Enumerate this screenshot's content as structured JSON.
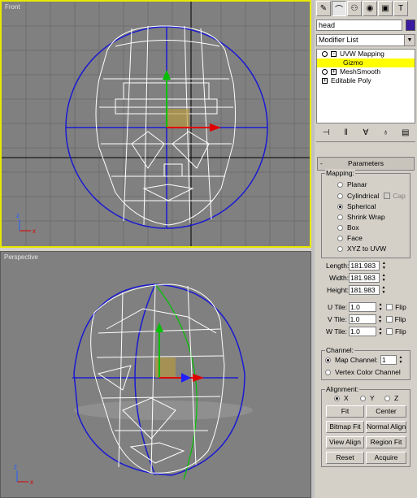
{
  "viewports": {
    "front_label": "Front",
    "perspective_label": "Perspective",
    "axis_x": "x",
    "axis_z": "z"
  },
  "command_panel": {
    "tabs": [
      "create-icon",
      "modify-icon",
      "hierarchy-icon",
      "motion-icon",
      "display-icon",
      "utilities-icon"
    ],
    "object_name": "head",
    "object_color": "#3a1b9f",
    "modifier_list": "Modifier List",
    "stack": {
      "uvw_mapping": "UVW Mapping",
      "gizmo": "Gizmo",
      "meshsmooth": "MeshSmooth",
      "editable_poly": "Editable Poly"
    }
  },
  "parameters": {
    "rollout_title": "Parameters",
    "mapping_title": "Mapping:",
    "mapping_options": [
      "Planar",
      "Cylindrical",
      "Spherical",
      "Shrink Wrap",
      "Box",
      "Face",
      "XYZ to UVW"
    ],
    "cap_label": "Cap",
    "length_label": "Length:",
    "length_value": "181.983",
    "width_label": "Width:",
    "width_value": "181.983",
    "height_label": "Height:",
    "height_value": "181.983",
    "utile_label": "U Tile:",
    "utile_value": "1.0",
    "vtile_label": "V Tile:",
    "vtile_value": "1.0",
    "wtile_label": "W Tile:",
    "wtile_value": "1.0",
    "flip_label": "Flip",
    "channel_title": "Channel:",
    "map_channel_label": "Map Channel:",
    "map_channel_value": "1",
    "vertex_color_channel": "Vertex Color Channel",
    "alignment_title": "Alignment:",
    "align_x": "X",
    "align_y": "Y",
    "align_z": "Z",
    "buttons": [
      "Fit",
      "Center",
      "Bitmap Fit",
      "Normal Align",
      "View Align",
      "Region Fit",
      "Reset",
      "Acquire"
    ]
  }
}
